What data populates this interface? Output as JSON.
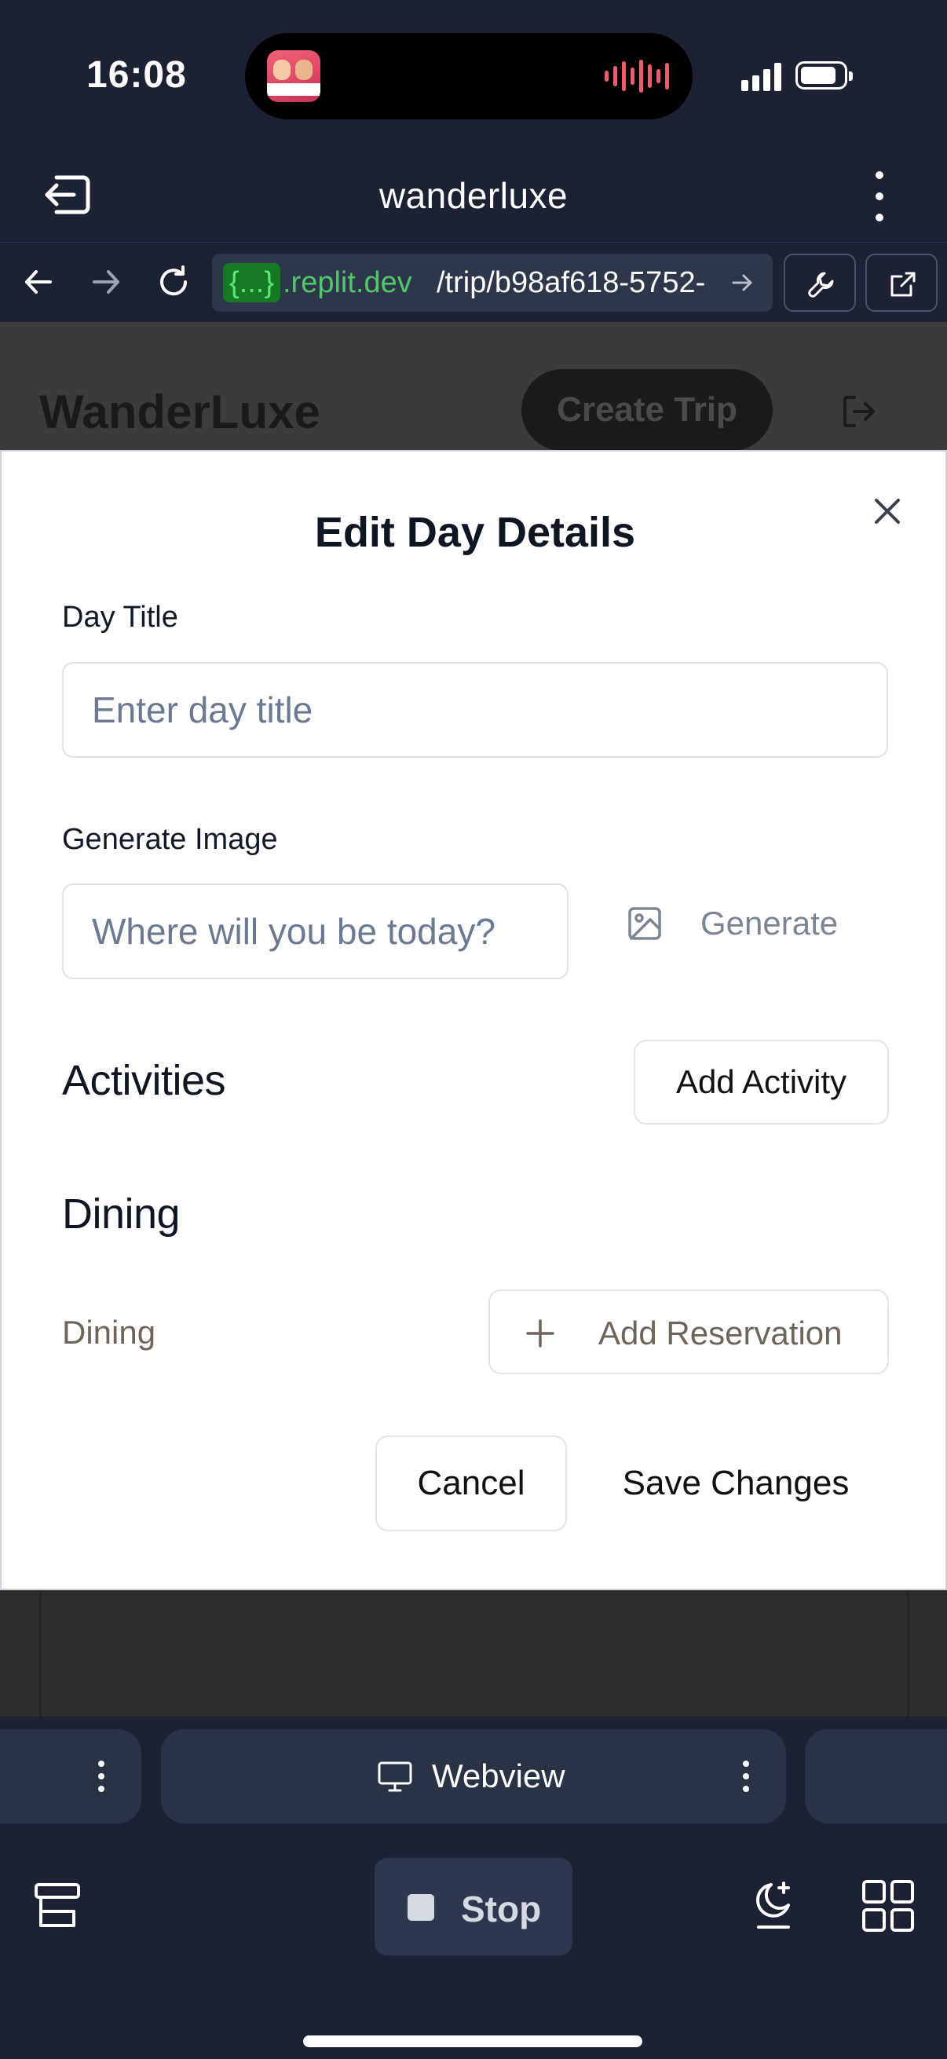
{
  "status_bar": {
    "time": "16:08"
  },
  "app_header": {
    "title": "wanderluxe"
  },
  "browser": {
    "url_badge": "{...}",
    "url_domain": ".replit.dev",
    "url_path": "/trip/b98af618-5752-"
  },
  "page": {
    "brand": "WanderLuxe",
    "create_trip_label": "Create Trip"
  },
  "modal": {
    "title": "Edit Day Details",
    "day_title_label": "Day Title",
    "day_title_placeholder": "Enter day title",
    "generate_image_label": "Generate Image",
    "generate_image_placeholder": "Where will you be today?",
    "generate_button_label": "Generate",
    "activities_heading": "Activities",
    "add_activity_label": "Add Activity",
    "dining_heading": "Dining",
    "dining_label": "Dining",
    "add_reservation_label": "Add Reservation",
    "cancel_label": "Cancel",
    "save_label": "Save Changes"
  },
  "bottom": {
    "active_tab_label": "Webview",
    "stop_label": "Stop"
  },
  "colors": {
    "chrome_bg": "#1c2234",
    "url_green": "#4fc965",
    "placeholder_gray": "#6b7a92",
    "dining_muted": "#6e655a"
  },
  "icons": [
    "exit-icon",
    "kebab-menu-icon",
    "back-arrow-icon",
    "forward-arrow-icon",
    "reload-icon",
    "wrench-icon",
    "open-external-icon",
    "close-icon",
    "image-icon",
    "plus-icon",
    "monitor-icon",
    "layers-icon",
    "sparkle-moon-icon",
    "grid-icon"
  ]
}
